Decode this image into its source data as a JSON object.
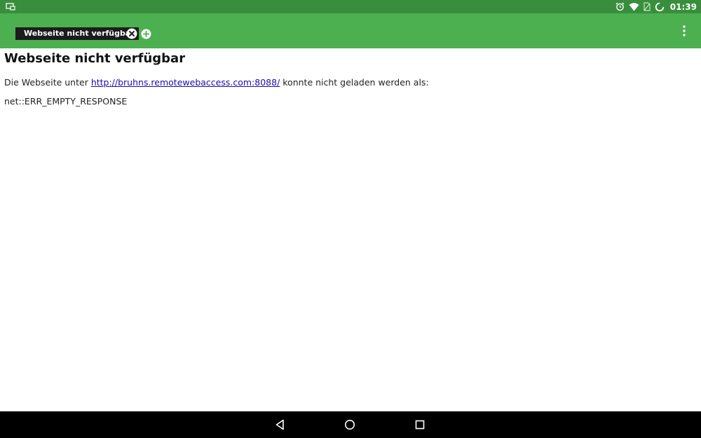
{
  "status_bar": {
    "time": "01:39",
    "icons": [
      "screen-cast-icon",
      "alarm-icon",
      "wifi-icon",
      "no-sim-icon",
      "loading-icon"
    ]
  },
  "toolbar": {
    "tabs": [
      {
        "label": "Webseite nicht verfügbar"
      }
    ],
    "icons": [
      "close-tab-icon",
      "add-tab-icon",
      "overflow-menu-icon"
    ]
  },
  "page": {
    "title": "Webseite nicht verfügbar",
    "message_prefix": "Die Webseite unter ",
    "url": "http://bruhns.remotewebaccess.com:8088/",
    "message_suffix": " konnte nicht geladen werden als:",
    "error_code": "net::ERR_EMPTY_RESPONSE"
  },
  "nav_bar": {
    "icons": [
      "back-icon",
      "home-icon",
      "recents-icon"
    ]
  },
  "colors": {
    "status_bar": "#388e3c",
    "toolbar": "#4caf50",
    "tab_background": "#1c1c1c",
    "link": "#1a0dab",
    "nav_bar": "#000000"
  }
}
